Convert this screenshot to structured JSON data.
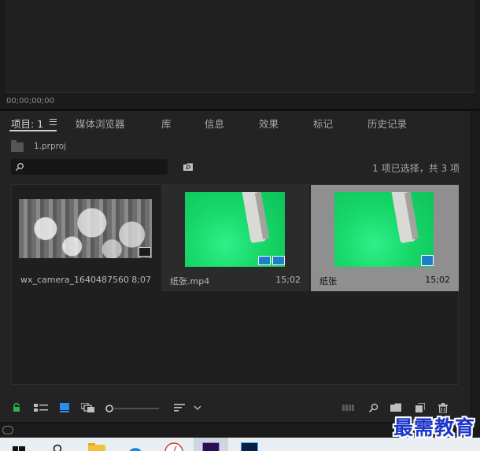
{
  "monitor": {
    "timecode": "00;00;00;00"
  },
  "tabs": [
    {
      "label": "项目: 1",
      "active": true
    },
    {
      "label": "媒体浏览器"
    },
    {
      "label": "库"
    },
    {
      "label": "信息"
    },
    {
      "label": "效果"
    },
    {
      "label": "标记"
    },
    {
      "label": "历史记录"
    }
  ],
  "project": {
    "file_name": "1.prproj",
    "search_placeholder": "",
    "selection_status": "1 项已选择，共 3 项"
  },
  "items": [
    {
      "name": "wx_camera_16404875607...",
      "duration": "8;07",
      "type": "video",
      "state": "normal"
    },
    {
      "name": "纸张.mp4",
      "duration": "15;02",
      "type": "video-audio",
      "state": "hover"
    },
    {
      "name": "纸张",
      "duration": "15;02",
      "type": "sequence",
      "state": "selected"
    }
  ],
  "colors": {
    "accent": "#1c7fc7",
    "lock_green": "#2fb64a",
    "selection_bg": "#8f8f8f",
    "watermark": "#1d36c9"
  },
  "toolbar": {
    "left_icons": [
      "lock-icon",
      "list-view-icon",
      "icon-view-icon",
      "freeform-view-icon",
      "zoom-slider",
      "sort-icon"
    ],
    "right_icons": [
      "automate-to-sequence-icon",
      "find-icon",
      "new-bin-icon",
      "new-item-icon",
      "clear-icon"
    ]
  },
  "taskbar": {
    "icons": [
      "windows-start-icon",
      "search-icon",
      "file-explorer-icon",
      "edge-icon",
      "clock-app-icon",
      "premiere-icon",
      "photoshop-icon"
    ]
  },
  "watermark": "最需教育"
}
